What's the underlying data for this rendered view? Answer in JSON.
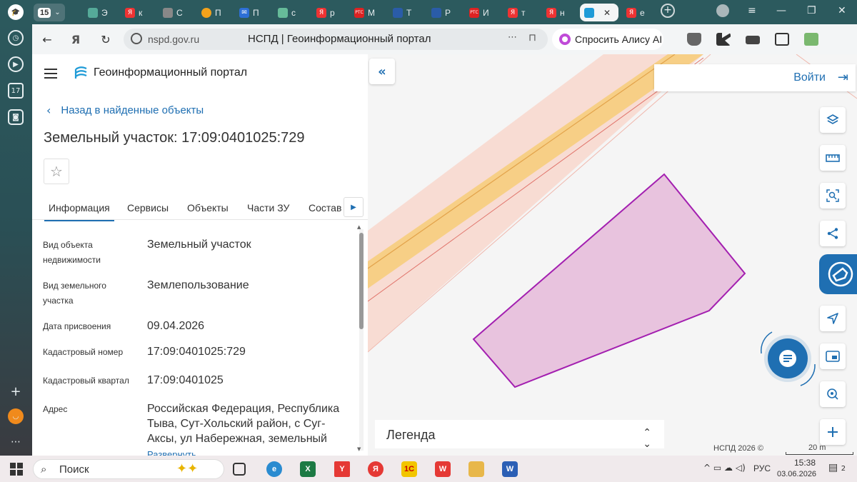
{
  "browser": {
    "tab_count": "15",
    "tabs": [
      "Э",
      "к",
      "С",
      "П",
      "П",
      "с",
      "р",
      "М",
      "Т",
      "Р",
      "И",
      "т",
      "н",
      "",
      "е"
    ],
    "url": "nspd.gov.ru",
    "page_title": "НСПД | Геоинформационный портал",
    "alice_label": "Спросить Алису AI",
    "sidebar_badge": "17"
  },
  "panel": {
    "portal_title": "Геоинформационный портал",
    "back_label": "Назад в найденные объекты",
    "object_title": "Земельный участок: 17:09:0401025:729",
    "tabs": [
      "Информация",
      "Сервисы",
      "Объекты",
      "Части ЗУ",
      "Состав"
    ],
    "properties": [
      {
        "label": "Вид объекта недвижимости",
        "value": "Земельный участок"
      },
      {
        "label": "Вид земельного участка",
        "value": "Землепользование"
      },
      {
        "label": "Дата присвоения",
        "value": "09.04.2026"
      },
      {
        "label": "Кадастровый номер",
        "value": "17:09:0401025:729"
      },
      {
        "label": "Кадастровый квартал",
        "value": "17:09:0401025"
      },
      {
        "label": "Адрес",
        "value": "Российская Федерация, Республика Тыва, Сут-Хольский район, с Суг-Аксы, ул Набережная, земельный"
      }
    ],
    "expand_label": "Развернуть"
  },
  "map": {
    "login_label": "Войти",
    "legend_label": "Легенда",
    "copyright": "НСПД 2026 ©",
    "scale": "20 m",
    "colors": {
      "parcel_fill": "#e8c3de",
      "parcel_stroke": "#a31fb0",
      "road": "#f7cf86",
      "zone": "#f8dcd3",
      "accent": "#1f6fb2"
    }
  },
  "taskbar": {
    "search_label": "Поиск",
    "language": "РУС",
    "time": "15:38",
    "date": "03.06.2026",
    "notifications": "2"
  }
}
